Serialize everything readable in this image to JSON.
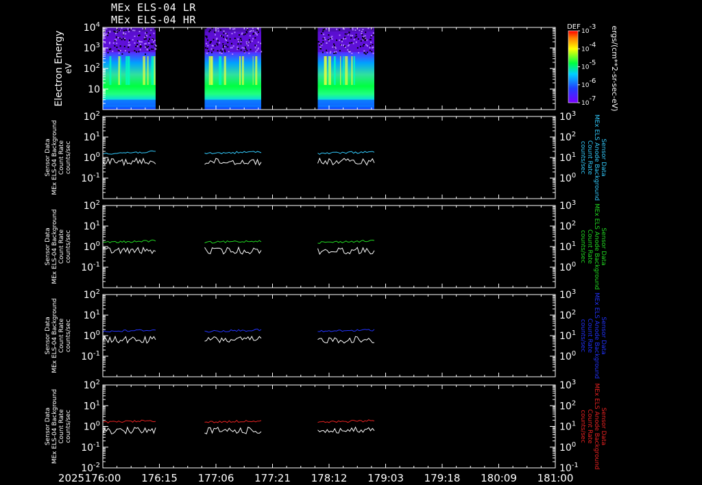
{
  "titles": [
    "MEx ELS-04 LR",
    "MEx ELS-04 HR"
  ],
  "time_axis": {
    "year": "2025",
    "tick_labels": [
      "176:00",
      "176:15",
      "177:06",
      "177:21",
      "178:12",
      "179:03",
      "179:18",
      "180:09",
      "181:00"
    ]
  },
  "colorbar": {
    "label": "DEF",
    "unit": "ergs/(cm**2-sr-sec-eV)",
    "tick_exponents": [
      -3,
      -4,
      -5,
      -6,
      -7
    ]
  },
  "data_segments": [
    {
      "start": "176:00",
      "end": "176:14"
    },
    {
      "start": "177:03",
      "end": "177:18"
    },
    {
      "start": "178:09",
      "end": "178:24"
    }
  ],
  "chart_data": [
    {
      "type": "heatmap",
      "ylabel": "Electron Energy",
      "yunit": "eV",
      "yscale": "log",
      "ylim": [
        1,
        10000
      ],
      "y_tick_labels": [
        {
          "base": "10",
          "exp": "4"
        },
        {
          "base": "10",
          "exp": "3"
        },
        {
          "base": "10",
          "exp": "2"
        },
        {
          "base": "10",
          "exp": ""
        }
      ],
      "colorscale_units": "DEF ergs/(cm**2-sr-sec-eV)",
      "color_range": [
        1e-07,
        0.001
      ]
    },
    {
      "type": "line",
      "ylabel_left": [
        "Sensor Data",
        "MEx ELS-04 Background",
        "Count Rate",
        "counts/sec"
      ],
      "ylabel_right": [
        "Sensor Data",
        "MEx ELS Anode Background",
        "Count Rate",
        "counts/sec"
      ],
      "right_color": "#33ccff",
      "yscale": "log",
      "ylim_left": [
        0.01,
        100
      ],
      "ylim_right": [
        0.1,
        1000
      ],
      "y_tick_labels_left": [
        {
          "base": "10",
          "exp": "2"
        },
        {
          "base": "10",
          "exp": "1"
        },
        {
          "base": "10",
          "exp": "0"
        },
        {
          "base": "10",
          "exp": "-1"
        }
      ],
      "y_tick_labels_right": [
        {
          "base": "10",
          "exp": "3"
        },
        {
          "base": "10",
          "exp": "2"
        },
        {
          "base": "10",
          "exp": "1"
        },
        {
          "base": "10",
          "exp": "0"
        }
      ],
      "series": [
        {
          "color": "#ffffff",
          "level": 0.5
        },
        {
          "color": "#33ccff",
          "level": 0.8
        }
      ]
    },
    {
      "type": "line",
      "ylabel_left": [
        "Sensor Data",
        "MEx ELS-04 Background",
        "Count Rate",
        "counts/sec"
      ],
      "ylabel_right": [
        "Sensor Data",
        "MEx ELS Anode Background",
        "Count Rate",
        "counts/sec"
      ],
      "right_color": "#22dd22",
      "yscale": "log",
      "ylim_left": [
        0.01,
        100
      ],
      "ylim_right": [
        0.1,
        1000
      ],
      "y_tick_labels_left": [
        {
          "base": "10",
          "exp": "2"
        },
        {
          "base": "10",
          "exp": "1"
        },
        {
          "base": "10",
          "exp": "0"
        },
        {
          "base": "10",
          "exp": "-1"
        }
      ],
      "y_tick_labels_right": [
        {
          "base": "10",
          "exp": "3"
        },
        {
          "base": "10",
          "exp": "2"
        },
        {
          "base": "10",
          "exp": "1"
        },
        {
          "base": "10",
          "exp": "0"
        }
      ],
      "series": [
        {
          "color": "#ffffff",
          "level": 0.5
        },
        {
          "color": "#22dd22",
          "level": 0.85
        }
      ]
    },
    {
      "type": "line",
      "ylabel_left": [
        "Sensor Data",
        "MEx ELS-04 Background",
        "Count Rate",
        "counts/sec"
      ],
      "ylabel_right": [
        "Sensor Data",
        "MEx ELS Anode Background",
        "Count Rate",
        "counts/sec"
      ],
      "right_color": "#2233ff",
      "yscale": "log",
      "ylim_left": [
        0.01,
        100
      ],
      "ylim_right": [
        0.1,
        1000
      ],
      "y_tick_labels_left": [
        {
          "base": "10",
          "exp": "2"
        },
        {
          "base": "10",
          "exp": "1"
        },
        {
          "base": "10",
          "exp": "0"
        },
        {
          "base": "10",
          "exp": "-1"
        }
      ],
      "y_tick_labels_right": [
        {
          "base": "10",
          "exp": "3"
        },
        {
          "base": "10",
          "exp": "2"
        },
        {
          "base": "10",
          "exp": "1"
        },
        {
          "base": "10",
          "exp": "0"
        }
      ],
      "series": [
        {
          "color": "#ffffff",
          "level": 0.5
        },
        {
          "color": "#2233ff",
          "level": 0.9
        }
      ]
    },
    {
      "type": "line",
      "ylabel_left": [
        "Sensor Data",
        "MEx ELS-04 Background",
        "Count Rate",
        "counts/sec"
      ],
      "ylabel_right": [
        "Sensor Data",
        "MEx ELS Anode Background",
        "Count Rate",
        "counts/sec"
      ],
      "right_color": "#ee2222",
      "yscale": "log",
      "ylim_left": [
        0.01,
        100
      ],
      "ylim_right": [
        0.1,
        1000
      ],
      "y_tick_labels_left": [
        {
          "base": "10",
          "exp": "2"
        },
        {
          "base": "10",
          "exp": "1"
        },
        {
          "base": "10",
          "exp": "0"
        },
        {
          "base": "10",
          "exp": "-1"
        },
        {
          "base": "10",
          "exp": "-2"
        }
      ],
      "y_tick_labels_right": [
        {
          "base": "10",
          "exp": "3"
        },
        {
          "base": "10",
          "exp": "2"
        },
        {
          "base": "10",
          "exp": "1"
        },
        {
          "base": "10",
          "exp": "0"
        },
        {
          "base": "10",
          "exp": "-1"
        }
      ],
      "series": [
        {
          "color": "#ffffff",
          "level": 0.45
        },
        {
          "color": "#ee2222",
          "level": 0.8
        }
      ]
    }
  ]
}
